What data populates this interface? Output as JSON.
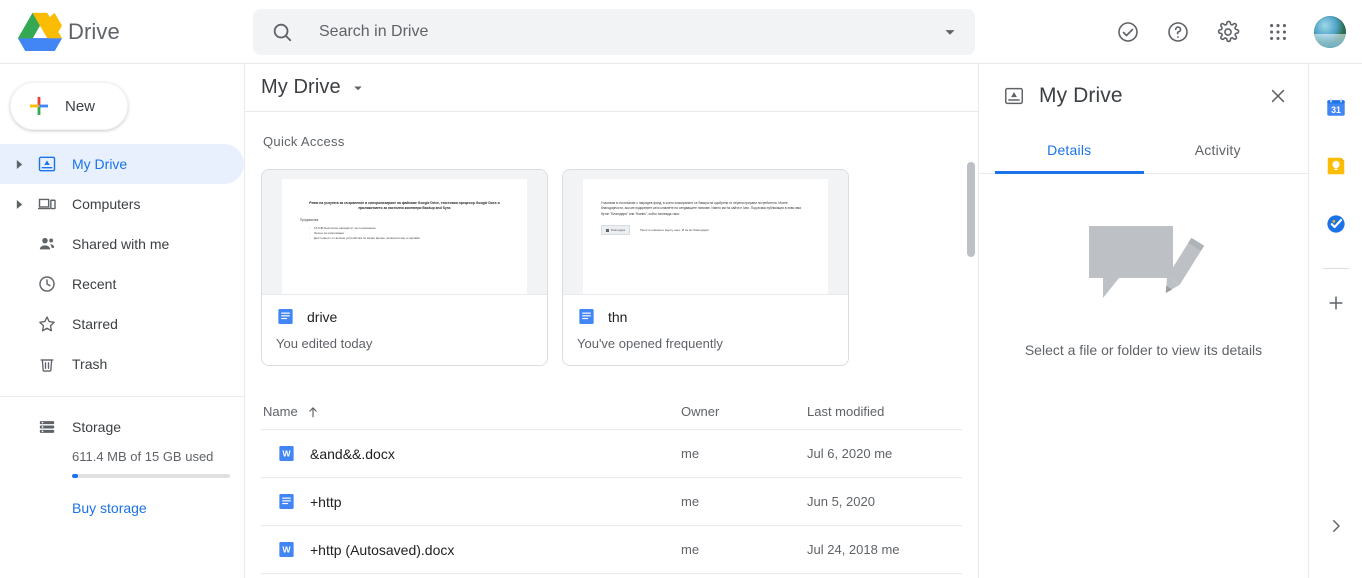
{
  "brand": {
    "name": "Drive",
    "logo_icon": "drive-logo"
  },
  "search": {
    "placeholder": "Search in Drive",
    "value": "",
    "icon": "search-icon",
    "options_icon": "chevron-down-icon"
  },
  "topbar_actions": [
    {
      "name": "support-icon",
      "title": "Support"
    },
    {
      "name": "help-icon",
      "title": "Help"
    },
    {
      "name": "settings-gear-icon",
      "title": "Settings"
    },
    {
      "name": "google-apps-icon",
      "title": "Google apps"
    }
  ],
  "account": {
    "avatar_name": "account-avatar"
  },
  "sidebar": {
    "new_button": {
      "label": "New",
      "icon": "plus-icon"
    },
    "items": [
      {
        "label": "My Drive",
        "icon": "my-drive-icon",
        "expandable": true,
        "active": true
      },
      {
        "label": "Computers",
        "icon": "computers-icon",
        "expandable": true,
        "active": false
      },
      {
        "label": "Shared with me",
        "icon": "shared-with-me-icon",
        "expandable": false,
        "active": false
      },
      {
        "label": "Recent",
        "icon": "clock-icon",
        "expandable": false,
        "active": false
      },
      {
        "label": "Starred",
        "icon": "star-icon",
        "expandable": false,
        "active": false
      },
      {
        "label": "Trash",
        "icon": "trash-icon",
        "expandable": false,
        "active": false
      }
    ],
    "storage": {
      "label": "Storage",
      "icon": "storage-icon",
      "usage_text": "611.4 MB of 15 GB used",
      "used_percent": 4,
      "buy_label": "Buy storage",
      "bar_color": "#1a73e8"
    }
  },
  "main": {
    "breadcrumb": {
      "title": "My Drive",
      "caret_icon": "chevron-down-icon"
    },
    "view_toggle": {
      "grid_icon": "grid-view-icon"
    },
    "details_toggle": {
      "icon": "info-icon",
      "active": true,
      "accent": "#1a73e8"
    },
    "quick_access": {
      "title": "Quick Access",
      "cards": [
        {
          "file_name": "drive",
          "subtitle": "You edited today",
          "file_type_icon": "google-docs-icon",
          "preview": {
            "heading": "Ревю на услугата за съхранение и синхронизиране на файлове Google Drive, текстовия процесор Google Docs и приложението за настолни компютри Backup and Sync",
            "sub": "Предимства:",
            "bullets": [
              "15 GB безплатен капацитет за съхранение",
              "Лесен за използване",
              "Достъпност от всички устройства по всяко време, включително и офлайн"
            ]
          }
        },
        {
          "file_name": "thn",
          "subtitle": "You've opened frequently",
          "file_type_icon": "google-docs-icon",
          "preview": {
            "paragraph": "Участвам в състезание с наградев фонд, в което класираните се базира на одобрени от нерегистрирани потребители. Моите благодарности, ако ме подкрепите като кликнете на следващите линкове. Името ми на сайта е Ivan. Под всяка публикация в ляво има бутон \"Благодаря\" или \"thanks\", който изглежда така:",
            "chip": "Благодаря",
            "note": "Просто кликнете върху него. И аз ви благодаря!"
          }
        }
      ]
    },
    "file_table": {
      "columns": [
        "Name",
        "Owner",
        "Last modified"
      ],
      "sort": {
        "column": "Name",
        "direction": "asc",
        "icon": "arrow-up-icon"
      },
      "rows": [
        {
          "name": "&and&&.docx",
          "owner": "me",
          "last_modified": "Jul 6, 2020 me",
          "icon": "word-doc-icon"
        },
        {
          "name": "+http",
          "owner": "me",
          "last_modified": "Jun 5, 2020",
          "icon": "google-docs-icon"
        },
        {
          "name": "+http (Autosaved).docx",
          "owner": "me",
          "last_modified": "Jul 24, 2018 me",
          "icon": "word-doc-icon"
        }
      ]
    }
  },
  "details_panel": {
    "icon": "my-drive-icon",
    "title": "My Drive",
    "close_icon": "close-icon",
    "tabs": [
      {
        "label": "Details",
        "active": true
      },
      {
        "label": "Activity",
        "active": false
      }
    ],
    "empty_state": {
      "text": "Select a file or folder to view its details",
      "illustration": "comment-pencil-illustration"
    }
  },
  "right_rail": {
    "apps": [
      {
        "name": "google-calendar-icon",
        "label": "Calendar",
        "day": "31"
      },
      {
        "name": "google-keep-icon",
        "label": "Keep"
      },
      {
        "name": "google-tasks-icon",
        "label": "Tasks"
      }
    ],
    "add_button": {
      "icon": "plus-icon"
    },
    "expand_button": {
      "icon": "chevron-right-icon"
    }
  }
}
